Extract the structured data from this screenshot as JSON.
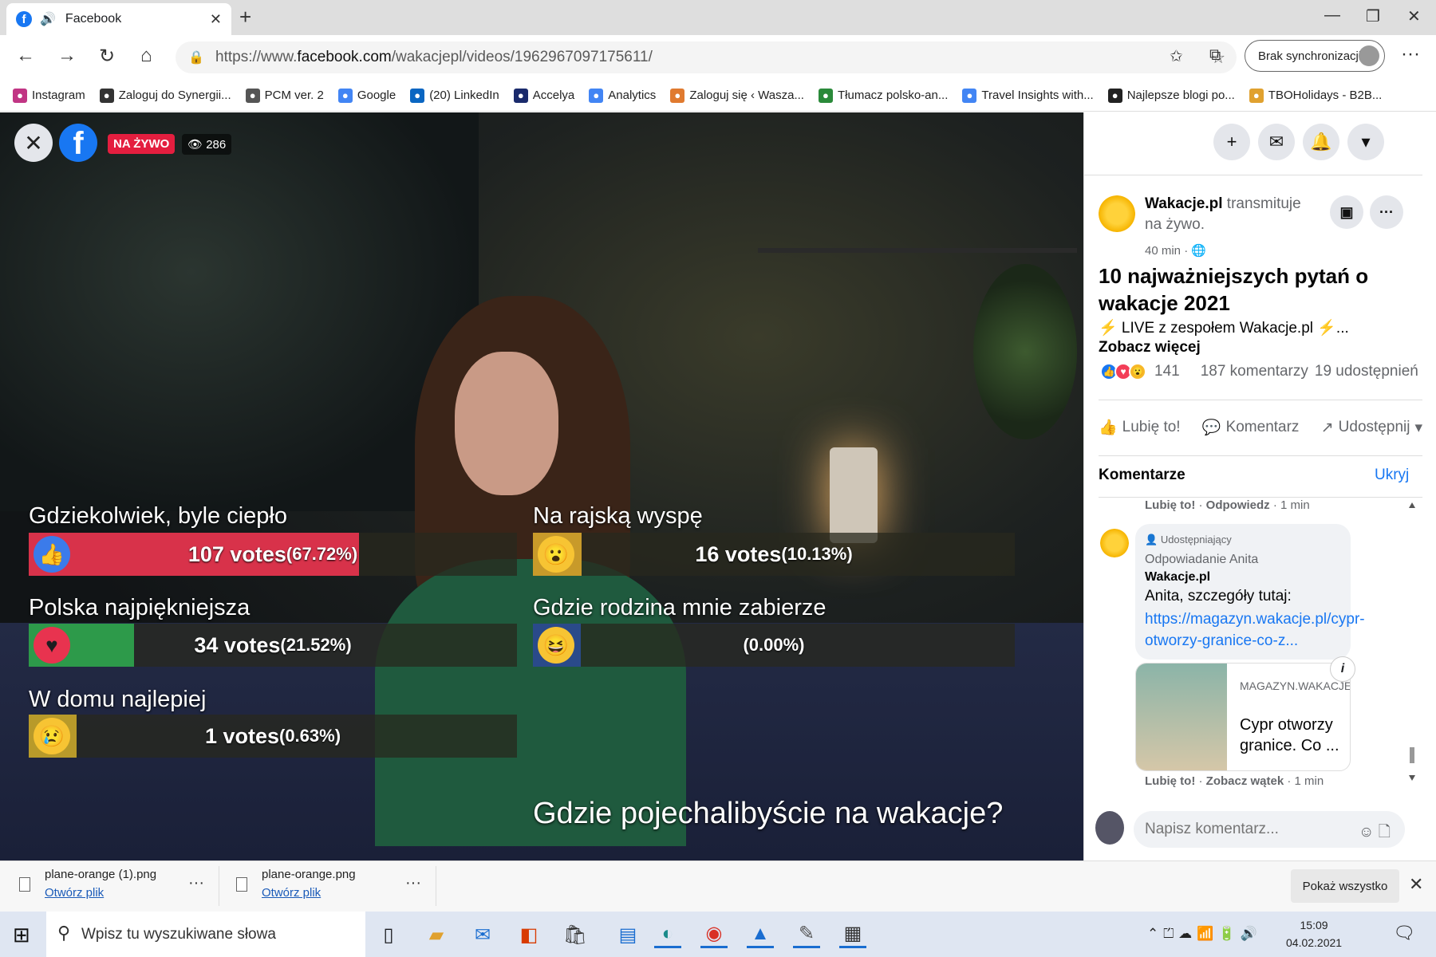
{
  "browser": {
    "tab_title": "Facebook",
    "url_prefix": "https://www.",
    "url_domain": "facebook.com",
    "url_path": "/wakacjepl/videos/1962967097175611/",
    "sync_label": "Brak synchronizacji",
    "bookmarks": [
      {
        "label": "Instagram",
        "icon": "instagram-icon",
        "color": "#c13584"
      },
      {
        "label": "Zaloguj do Synergii...",
        "icon": "synergia-icon",
        "color": "#333333"
      },
      {
        "label": "PCM ver. 2",
        "icon": "pcm-icon",
        "color": "#555555"
      },
      {
        "label": "Google",
        "icon": "google-icon",
        "color": "#4285f4"
      },
      {
        "label": "(20) LinkedIn",
        "icon": "linkedin-icon",
        "color": "#0a66c2"
      },
      {
        "label": "Accelya",
        "icon": "accelya-icon",
        "color": "#1a2a6c"
      },
      {
        "label": "Analytics",
        "icon": "google-icon",
        "color": "#4285f4"
      },
      {
        "label": "Zaloguj się ‹ Wasza...",
        "icon": "wt-icon",
        "color": "#e07a2f"
      },
      {
        "label": "Tłumacz polsko-an...",
        "icon": "translator-icon",
        "color": "#2a8a3a"
      },
      {
        "label": "Travel Insights with...",
        "icon": "google-icon",
        "color": "#4285f4"
      },
      {
        "label": "Najlepsze blogi po...",
        "icon": "blog-icon",
        "color": "#222222"
      },
      {
        "label": "TBOHolidays - B2B...",
        "icon": "tbo-icon",
        "color": "#e0a12f"
      }
    ]
  },
  "video": {
    "live_label": "NA ŻYWO",
    "viewers": "286",
    "poll_title": "Gdzie pojechalibyście na wakacje?",
    "poll": [
      {
        "question": "Gdziekolwiek, byle ciepło",
        "votes": "107 votes",
        "percent": "(67.72%)",
        "share": 0.6772,
        "emoji": "like-icon",
        "emoji_char": "👍",
        "fill_color": "#d8324a",
        "emoji_bg": "#3b7bea"
      },
      {
        "question": "Na rajską wyspę",
        "votes": "16 votes",
        "percent": "(10.13%)",
        "share": 0.1013,
        "emoji": "wow-icon",
        "emoji_char": "😮",
        "fill_color": "#c89a2a",
        "emoji_bg": "#f7c433"
      },
      {
        "question": "Polska najpiękniejsza",
        "votes": "34 votes",
        "percent": "(21.52%)",
        "share": 0.2152,
        "emoji": "love-icon",
        "emoji_char": "♥",
        "fill_color": "#2d9a4a",
        "emoji_bg": "#e8334f"
      },
      {
        "question": "Gdzie rodzina mnie zabierze",
        "votes": "",
        "percent": "(0.00%)",
        "share": 0.0,
        "emoji": "haha-icon",
        "emoji_char": "😆",
        "fill_color": "#2a4a8a",
        "emoji_bg": "#f7c433"
      },
      {
        "question": "W domu najlepiej",
        "votes": "1 votes",
        "percent": "(0.63%)",
        "share": 0.0063,
        "emoji": "sad-icon",
        "emoji_char": "😢",
        "fill_color": "#b89a2a",
        "emoji_bg": "#f7c433"
      }
    ]
  },
  "post": {
    "page_name": "Wakacje.pl",
    "action_text": "transmituje na żywo.",
    "time": "40 min ·",
    "title": "10 najważniejszych pytań o wakacje 2021",
    "description": "⚡ LIVE z zespołem Wakacje.pl ⚡...",
    "see_more": "Zobacz więcej",
    "reaction_count": "141",
    "comment_count": "187 komentarzy",
    "share_count": "19 udostępnień",
    "like_label": "Lubię to!",
    "comment_label": "Komentarz",
    "share_label": "Udostępnij"
  },
  "comments": {
    "header": "Komentarze",
    "hide": "Ukryj",
    "prev_like": "Lubię to!",
    "prev_reply": "Odpowiedz",
    "prev_time": "· 1 min",
    "role": "Udostępniający",
    "reply_to": "Odpowiadanie Anita",
    "author": "Wakacje.pl",
    "text": "Anita, szczegóły tutaj:",
    "link": "https://magazyn.wakacje.pl/cypr-otworzy-granice-co-z...",
    "card_domain": "MAGAZYN.WAKACJE.PL",
    "card_title": "Cypr otworzy granice. Co ...",
    "like": "Lubię to!",
    "thread": "Zobacz wątek",
    "time": "· 1 min",
    "input_placeholder": "Napisz komentarz..."
  },
  "downloads": [
    {
      "name": "plane-orange (1).png",
      "action": "Otwórz plik"
    },
    {
      "name": "plane-orange.png",
      "action": "Otwórz plik"
    }
  ],
  "downloads_show_all": "Pokaż wszystko",
  "taskbar": {
    "search_placeholder": "Wpisz tu wyszukiwane słowa",
    "time": "15:09",
    "date": "04.02.2021"
  }
}
